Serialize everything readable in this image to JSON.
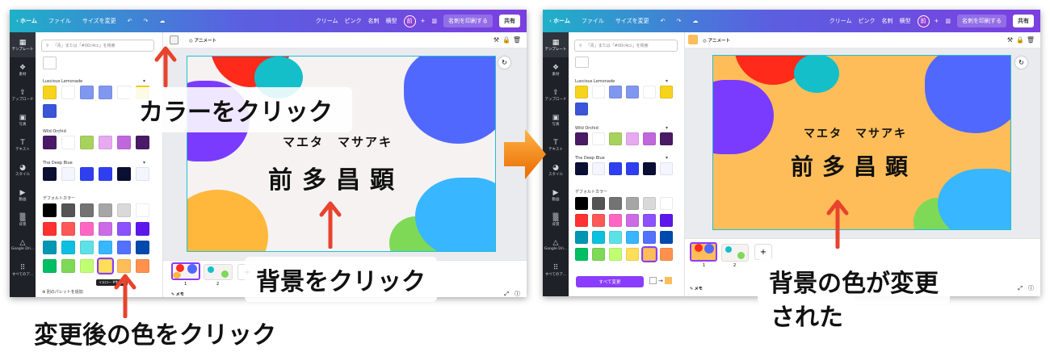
{
  "topbar": {
    "home": "ホーム",
    "file": "ファイル",
    "resize": "サイズを変更",
    "tags": [
      "クリーム",
      "ピンク",
      "名刺",
      "横型"
    ],
    "avatar": "前",
    "print": "名刺を印刷する",
    "share": "共有"
  },
  "rail": [
    "テンプレート",
    "素材",
    "アップロード",
    "写真",
    "テキスト",
    "スタイル",
    "動画",
    "背景",
    "Google Dri...",
    "すべてのア..."
  ],
  "panel": {
    "search_placeholder": "「青」または「#00c4cc」を検索",
    "palettes": [
      {
        "name": "Luscious Lemonade",
        "colors": [
          "#f7d31c",
          "#ffffff",
          "#8097f0",
          "#8097f0",
          "#ffffff",
          "#f7d31c",
          "#3a55d8"
        ]
      },
      {
        "name": "Wild Orchid",
        "colors": [
          "#4a1a66",
          "#ffffff",
          "#a8d25e",
          "#e7a9f0",
          "#c167dc",
          "#4a1a66"
        ]
      },
      {
        "name": "The Deep Blue",
        "colors": [
          "#0a0f33",
          "#f3f6ff",
          "#2f3ff0",
          "#2f3ff0",
          "#0a0f33",
          "#f3f6ff"
        ]
      }
    ],
    "default_label": "デフォルトカラー",
    "default_colors": [
      "#000000",
      "#545454",
      "#737373",
      "#a6a6a6",
      "#d9d9d9",
      "#ffffff",
      "#ff3131",
      "#ff5757",
      "#ff66c4",
      "#cb6ce6",
      "#8c52ff",
      "#5e17eb",
      "#0097b2",
      "#0cc0df",
      "#5ce1e6",
      "#38b6ff",
      "#5271ff",
      "#004aad",
      "#00bf63",
      "#7ed957",
      "#c1ff72",
      "#ffde59",
      "#ffbd59",
      "#ff914d"
    ],
    "add_palette": "別のパレットを追加",
    "tooltip": "イエロー #ffde59",
    "change_all": "すべて変更"
  },
  "context": {
    "animate": "アニメート"
  },
  "design": {
    "name_kana": "マエタ　マサアキ",
    "name_kanji": "前多昌顕"
  },
  "pages": [
    "1",
    "2"
  ],
  "bottom": {
    "memo": "メモ"
  },
  "callouts": {
    "click_color": "カラーをクリック",
    "click_background": "背景をクリック",
    "click_new_color": "変更後の色をクリック",
    "result_line1": "背景の色が変更",
    "result_line2": "された"
  },
  "colors": {
    "before_bg": "#f6f2f2",
    "after_bg": "#ffbd59",
    "arrow_red": "#e8432d",
    "arrow_orange": "#f08a10"
  }
}
